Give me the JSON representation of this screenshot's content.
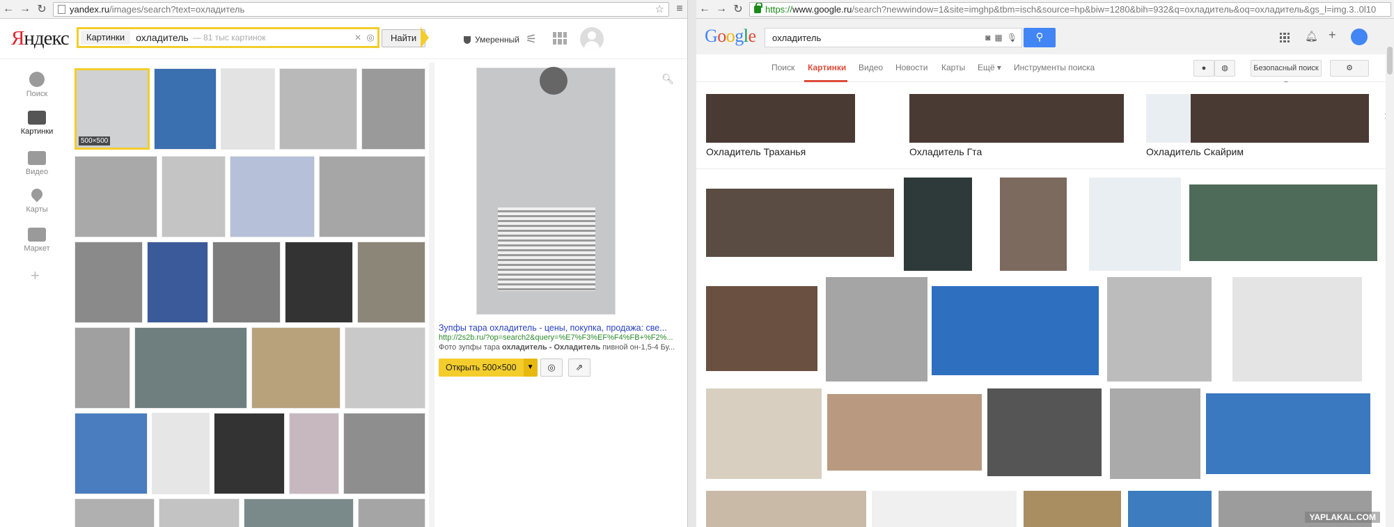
{
  "left_browser": {
    "url_host": "yandex.ru",
    "url_path": "/images/search?text=охладитель"
  },
  "yandex": {
    "logo_first": "Я",
    "logo_rest": "ндекс",
    "search_tag": "Картинки",
    "query": "охладитель",
    "result_count": "— 81 тыс картинок",
    "find_button": "Найти",
    "safe_search": "Умеренный",
    "sidebar": [
      {
        "label": "Поиск",
        "active": false
      },
      {
        "label": "Картинки",
        "active": true
      },
      {
        "label": "Видео",
        "active": false
      },
      {
        "label": "Карты",
        "active": false
      },
      {
        "label": "Маркет",
        "active": false
      }
    ],
    "selected_thumb_size": "500×500",
    "preview": {
      "title": "Зупфы тара охладитель - цены, покупка, продажа: све...",
      "url": "http://2s2b.ru/?op=search2&query=%E7%F3%EF%F4%FB+%F2%...",
      "description_prefix": "Фото зупфы тара ",
      "description_bold": "охладитель - Охладитель",
      "description_suffix": " пивной он-1,5-4 Бу...",
      "open_button": "Открыть 500×500"
    }
  },
  "right_browser": {
    "url_scheme": "https://",
    "url_host": "www.google.ru",
    "url_path": "/search?newwindow=1&site=imghp&tbm=isch&source=hp&biw=1280&bih=932&q=охладитель&oq=охладитель&gs_l=img.3..0l10"
  },
  "google": {
    "query": "охладитель",
    "tabs": [
      "Поиск",
      "Картинки",
      "Видео",
      "Новости",
      "Карты",
      "Ещё ▾",
      "Инструменты поиска"
    ],
    "active_tab": "Картинки",
    "safe_search": "Безопасный поиск ▾",
    "related": [
      "Охладитель Траханья",
      "Охладитель Гта",
      "Охладитель Скайрим"
    ]
  },
  "watermark": "YAPLAKAL.COM",
  "colors": {
    "yandex_yellow": "#f3cd2b",
    "yandex_red": "#e0232c",
    "google_blue": "#4285f4",
    "google_red": "#dd4b39",
    "link_blue": "#2a42c1",
    "link_green": "#2a8a2a"
  }
}
